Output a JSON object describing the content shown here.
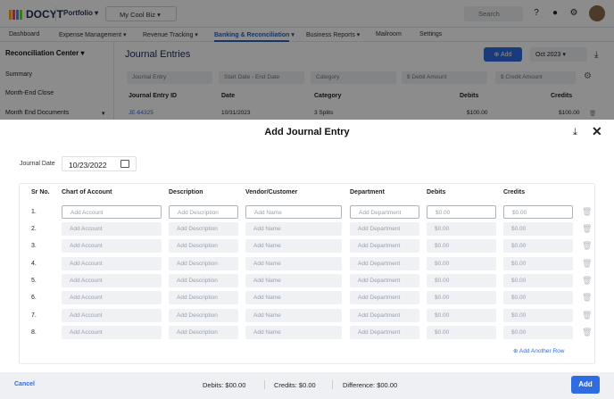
{
  "app": {
    "logo": "DOCYT",
    "portfolio": "Portfolio",
    "business": "My Cool Biz",
    "search_placeholder": "Search"
  },
  "nav": {
    "items": [
      "Dashboard",
      "Expense Management ▾",
      "Revenue Tracking ▾",
      "Banking & Reconciliation ▾",
      "Business Reports ▾",
      "Mailroom",
      "Settings"
    ]
  },
  "sidebar": {
    "header": "Reconciliation Center",
    "items": [
      "Summary",
      "Month-End Close",
      "Month End Documents"
    ]
  },
  "journal": {
    "title": "Journal Entries",
    "add_label": "Add",
    "month": "Oct 2023",
    "filters": {
      "entry": "Journal Entry",
      "dates": "Start Date - End Date",
      "category": "Category",
      "debit": "$ Debit Amount",
      "credit": "$ Credit Amount"
    },
    "columns": [
      "Journal Entry ID",
      "Date",
      "Category",
      "Debits",
      "Credits"
    ],
    "row": {
      "id": "JE-64325",
      "date": "10/31/2023",
      "category": "3 Splits",
      "debits": "$100.00",
      "credits": "$100.00"
    }
  },
  "modal": {
    "title": "Add Journal Entry",
    "journal_date_label": "Journal Date",
    "journal_date": "10/23/2022",
    "columns": [
      "Sr No.",
      "Chart of Account",
      "Description",
      "Vendor/Customer",
      "Department",
      "Debits",
      "Credits"
    ],
    "placeholders": {
      "account": "Add Account",
      "description": "Add Description",
      "name": "Add Name",
      "department": "Add Department",
      "debits": "$0.00",
      "credits": "$0.00"
    },
    "rows": [
      "1.",
      "2.",
      "3.",
      "4.",
      "5.",
      "6.",
      "7.",
      "8."
    ],
    "add_row": "Add Another Row"
  },
  "footer": {
    "cancel": "Cancel",
    "debits": "Debits: $00.00",
    "credits": "Credits: $0.00",
    "difference": "Difference: $00.00",
    "add": "Add"
  }
}
